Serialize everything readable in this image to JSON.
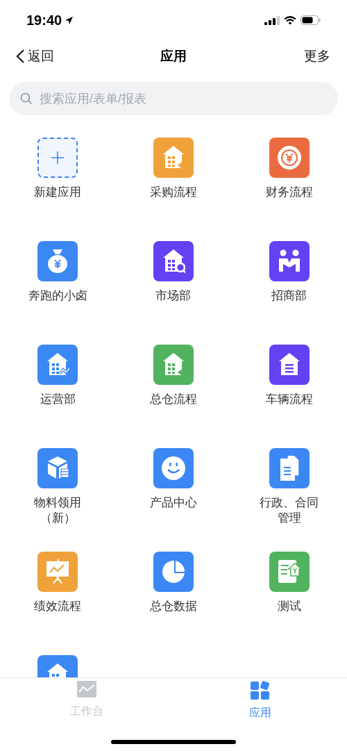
{
  "status_bar": {
    "time": "19:40"
  },
  "nav": {
    "back": "返回",
    "title": "应用",
    "more": "更多"
  },
  "search": {
    "placeholder": "搜索应用/表单/报表"
  },
  "apps": [
    {
      "name": "新建应用",
      "kind": "add",
      "color": "#3b82f6"
    },
    {
      "name": "采购流程",
      "kind": "house-arrow",
      "color": "#f0a23a"
    },
    {
      "name": "财务流程",
      "kind": "coin",
      "color": "#ea6b3f"
    },
    {
      "name": "奔跑的小卤",
      "kind": "money-bag",
      "color": "#3b88f5"
    },
    {
      "name": "市场部",
      "kind": "house-search",
      "color": "#6441f2"
    },
    {
      "name": "招商部",
      "kind": "people",
      "color": "#6441f2"
    },
    {
      "name": "运营部",
      "kind": "house-chart",
      "color": "#3b88f5"
    },
    {
      "name": "总仓流程",
      "kind": "house-arrow",
      "color": "#52b35f"
    },
    {
      "name": "车辆流程",
      "kind": "house-doc",
      "color": "#6441f2"
    },
    {
      "name": "物料领用（新）",
      "kind": "box",
      "color": "#3b88f5"
    },
    {
      "name": "产品中心",
      "kind": "smile",
      "color": "#3b88f5"
    },
    {
      "name": "行政、合同管理",
      "kind": "documents",
      "color": "#3b88f5"
    },
    {
      "name": "绩效流程",
      "kind": "presentation",
      "color": "#f0a23a"
    },
    {
      "name": "总仓数据",
      "kind": "pie",
      "color": "#3b88f5"
    },
    {
      "name": "测试",
      "kind": "note",
      "color": "#52b35f"
    },
    {
      "kind": "house",
      "color": "#3b88f5"
    }
  ],
  "tabs": [
    {
      "label": "工作台",
      "kind": "workbench",
      "selected": false
    },
    {
      "label": "应用",
      "kind": "apps",
      "selected": true
    }
  ]
}
